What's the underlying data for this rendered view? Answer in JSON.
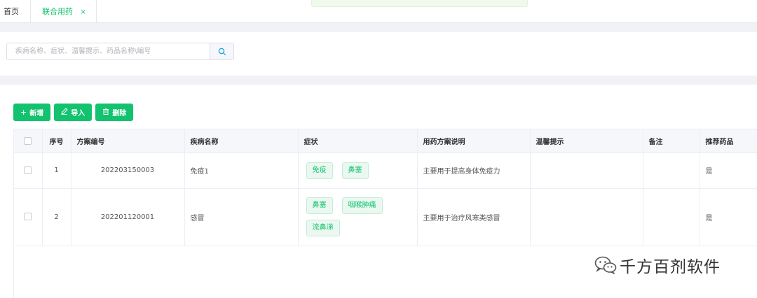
{
  "tabs": {
    "home": "首页",
    "active": "联合用药",
    "close": "×"
  },
  "search": {
    "placeholder": "疾病名称、症状、温馨提示、药品名称\\编号",
    "value": ""
  },
  "toolbar": {
    "add": "新增",
    "import": "导入",
    "delete": "删除"
  },
  "table": {
    "headers": [
      "序号",
      "方案编号",
      "疾病名称",
      "症状",
      "用药方案说明",
      "温馨提示",
      "备注",
      "推荐药品"
    ],
    "rows": [
      {
        "index": "1",
        "code": "202203150003",
        "disease": "免疫1",
        "symptoms": [
          "免疫",
          "鼻塞"
        ],
        "plan": "主要用于提高身体免疫力",
        "tips": "",
        "remark": "",
        "recommend": "是"
      },
      {
        "index": "2",
        "code": "202201120001",
        "disease": "感冒",
        "symptoms": [
          "鼻塞",
          "咽喉肿痛",
          "流鼻涕"
        ],
        "plan": "主要用于治疗风寒类感冒",
        "tips": "",
        "remark": "",
        "recommend": "是"
      }
    ]
  },
  "watermark": {
    "text": "千方百剂软件",
    "icon": "wechat-icon"
  },
  "colors": {
    "accent": "#13c26e",
    "tag_bg": "#eaf8f1",
    "header_bg": "#f5f7fa"
  }
}
